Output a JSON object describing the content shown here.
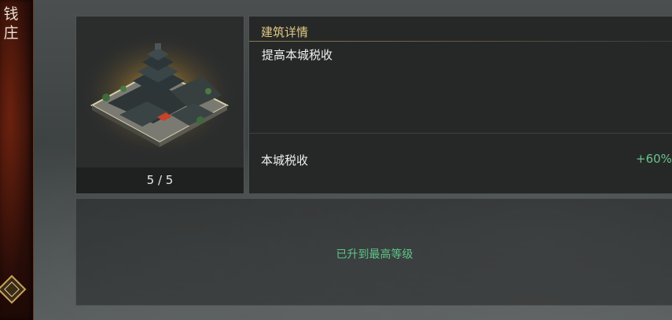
{
  "sidebar": {
    "title_chars": [
      "钱",
      "庄"
    ],
    "emblem_icon": "seal-emblem-icon"
  },
  "building": {
    "image_icon": "qianzhuang-building-illustration",
    "level": "5 / 5"
  },
  "details": {
    "title": "建筑详情",
    "description": "提高本城税收",
    "stat_label": "本城税收",
    "stat_value": "+60%"
  },
  "status": {
    "max_level_text": "已升到最高等级"
  },
  "colors": {
    "accent_gold": "#e2c884",
    "positive_green": "#6bc28d"
  }
}
